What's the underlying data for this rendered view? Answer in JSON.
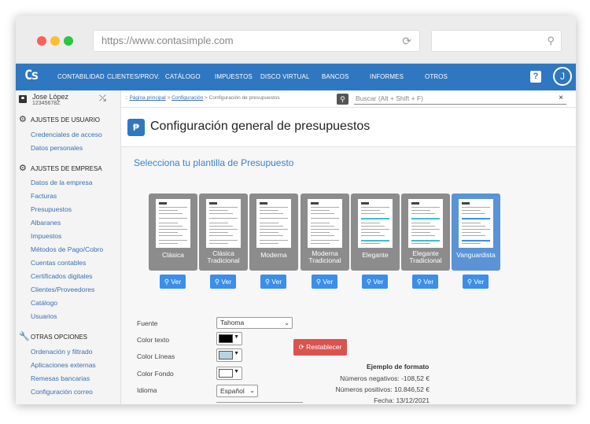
{
  "browser": {
    "url": "https://www.contasimple.com"
  },
  "app": {
    "logo_text": "Cs",
    "nav": [
      "CONTABILIDAD",
      "CLIENTES/PROV.",
      "CATÁLOGO",
      "IMPUESTOS",
      "DISCO VIRTUAL",
      "BANCOS",
      "INFORMES",
      "OTROS"
    ],
    "help_label": "?",
    "avatar_initial": "J"
  },
  "user": {
    "name": "Jose López",
    "id": "12345678Z"
  },
  "sidebar": {
    "sections": [
      {
        "title": "AJUSTES DE USUARIO",
        "items": [
          "Credenciales de acceso",
          "Datos personales"
        ]
      },
      {
        "title": "AJUSTES DE EMPRESA",
        "items": [
          "Datos de la empresa",
          "Facturas",
          "Presupuestos",
          "Albaranes",
          "Impuestos",
          "Métodos de Pago/Cobro",
          "Cuentas contables",
          "Certificados digitales",
          "Clientes/Proveedores",
          "Catálogo",
          "Usuarios"
        ]
      },
      {
        "title": "OTRAS OPCIONES",
        "items": [
          "Ordenación y filtrado",
          "Aplicaciones externas",
          "Remesas bancarias",
          "Configuración correo"
        ]
      }
    ]
  },
  "breadcrumb": {
    "home": "Página principal",
    "config": "Configuración",
    "current": "Configuración de presupuestos",
    "sep": ">",
    "prefix": "::"
  },
  "search": {
    "placeholder": "Buscar (Alt + Shift + F)",
    "clear": "×"
  },
  "page": {
    "title": "Configuración general de presupuestos",
    "subtitle": "Selecciona tu plantilla de Presupuesto"
  },
  "templates": [
    {
      "name": "Clásica",
      "accent": "#888888",
      "active": false
    },
    {
      "name": "Clásica Tradicional",
      "accent": "#888888",
      "active": false
    },
    {
      "name": "Moderna",
      "accent": "#888888",
      "active": false
    },
    {
      "name": "Moderna Tradicional",
      "accent": "#888888",
      "active": false
    },
    {
      "name": "Elegante",
      "accent": "#3cc0c8",
      "active": false
    },
    {
      "name": "Elegante Tradicional",
      "accent": "#3cc0c8",
      "active": false
    },
    {
      "name": "Vanguardista",
      "accent": "#3b8eea",
      "active": true
    }
  ],
  "view_button": "Ver",
  "form": {
    "font_label": "Fuente",
    "font_value": "Tahoma",
    "text_color_label": "Color texto",
    "text_color": "#000000",
    "line_color_label": "Color Líneas",
    "line_color": "#b9d3e0",
    "bg_color_label": "Color Fondo",
    "bg_color": "#ffffff",
    "language_label": "Idioma",
    "language_value": "Español",
    "reset_button": "Restablecer"
  },
  "example": {
    "title": "Ejemplo de formato",
    "negative": "Números negativos:   -108,52 €",
    "positive": "Números positivos: 10.846,52 €",
    "date": "Fecha: 13/12/2021"
  }
}
